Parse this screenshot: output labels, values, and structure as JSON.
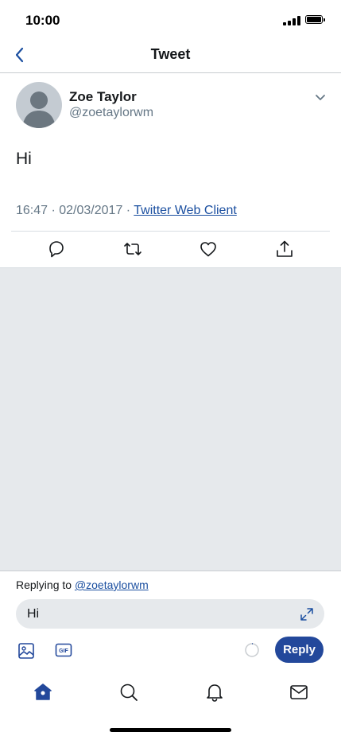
{
  "status_bar": {
    "time": "10:00"
  },
  "header": {
    "title": "Tweet"
  },
  "tweet": {
    "author_name": "Zoe Taylor",
    "author_handle": "@zoetaylorwm",
    "text": "Hi",
    "timestamp": "16:47 · 02/03/2017 · ",
    "source": "Twitter Web Client"
  },
  "actions": {
    "icons": [
      "reply-icon",
      "retweet-icon",
      "like-icon",
      "share-icon"
    ]
  },
  "composer": {
    "replying_prefix": "Replying to ",
    "replying_handle": "@zoetaylorwm",
    "input_value": "Hi",
    "reply_label": "Reply"
  },
  "tab_bar": {
    "icons": [
      "home-icon",
      "search-icon",
      "notifications-icon",
      "messages-icon"
    ]
  },
  "colors": {
    "accent": "#23489b",
    "link": "#1b4fa0",
    "secondary_text": "#657786",
    "surface_gray": "#e6e9ec"
  }
}
